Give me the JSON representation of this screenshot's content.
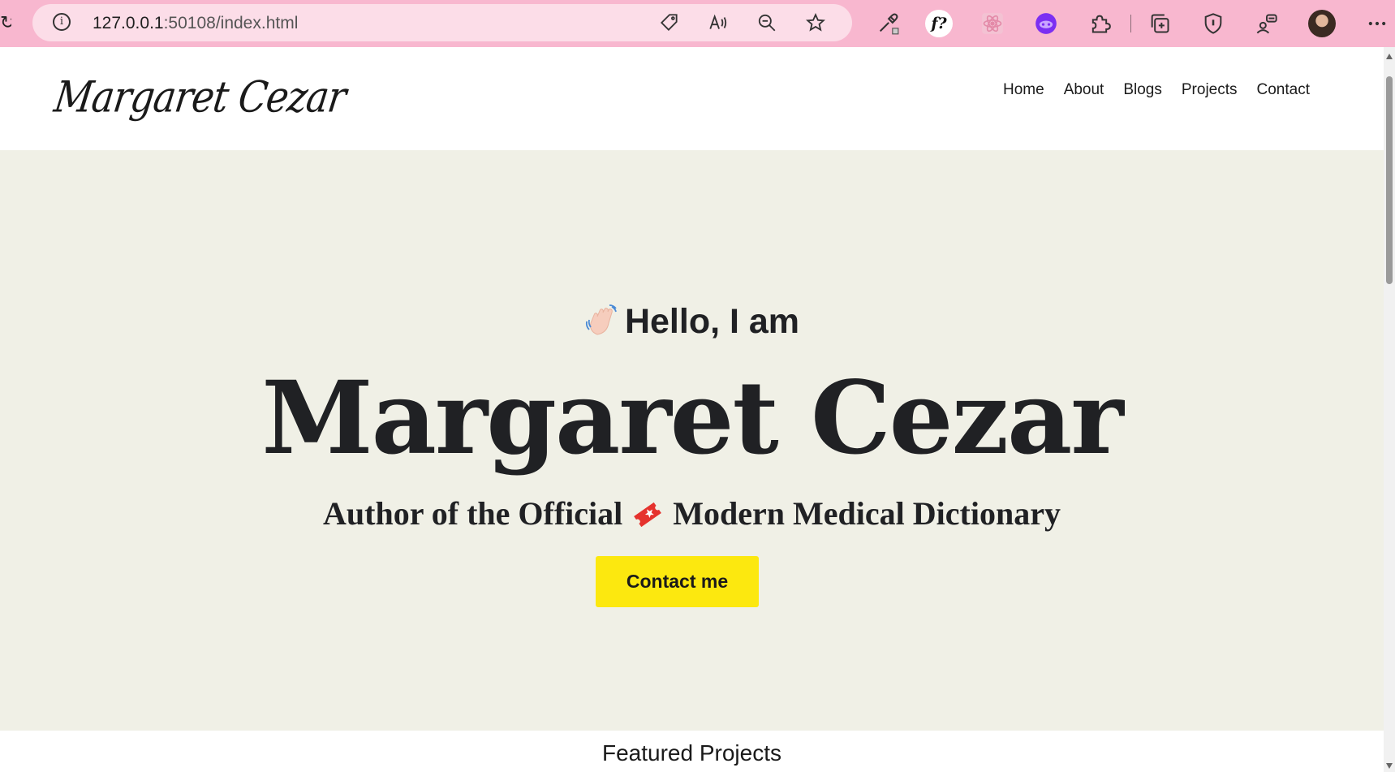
{
  "browser": {
    "url_host": "127.0.0.1",
    "url_rest": ":50108/index.html",
    "toolbar_color": "#f8b7cf",
    "icons": [
      "reload-icon",
      "site-info-icon",
      "tag-icon",
      "read-aloud-icon",
      "zoom-out-icon",
      "favorite-star-icon",
      "eyedropper-icon",
      "font-identify-icon",
      "react-devtools-icon",
      "mask-extension-icon",
      "extensions-puzzle-icon",
      "collections-icon",
      "browser-essentials-icon",
      "profile-share-icon",
      "profile-avatar",
      "more-menu-icon"
    ],
    "font_ext_label": "f?"
  },
  "site": {
    "logo": "Margaret Cezar",
    "nav": [
      "Home",
      "About",
      "Blogs",
      "Projects",
      "Contact"
    ]
  },
  "hero": {
    "greeting": "Hello, I am",
    "name": "Margaret Cezar",
    "tagline_before": "Author of the Official",
    "tagline_after": "Modern Medical Dictionary",
    "cta_label": "Contact me",
    "background": "#f0f0e6",
    "cta_color": "#fce80f"
  },
  "featured": {
    "heading": "Featured Projects"
  }
}
